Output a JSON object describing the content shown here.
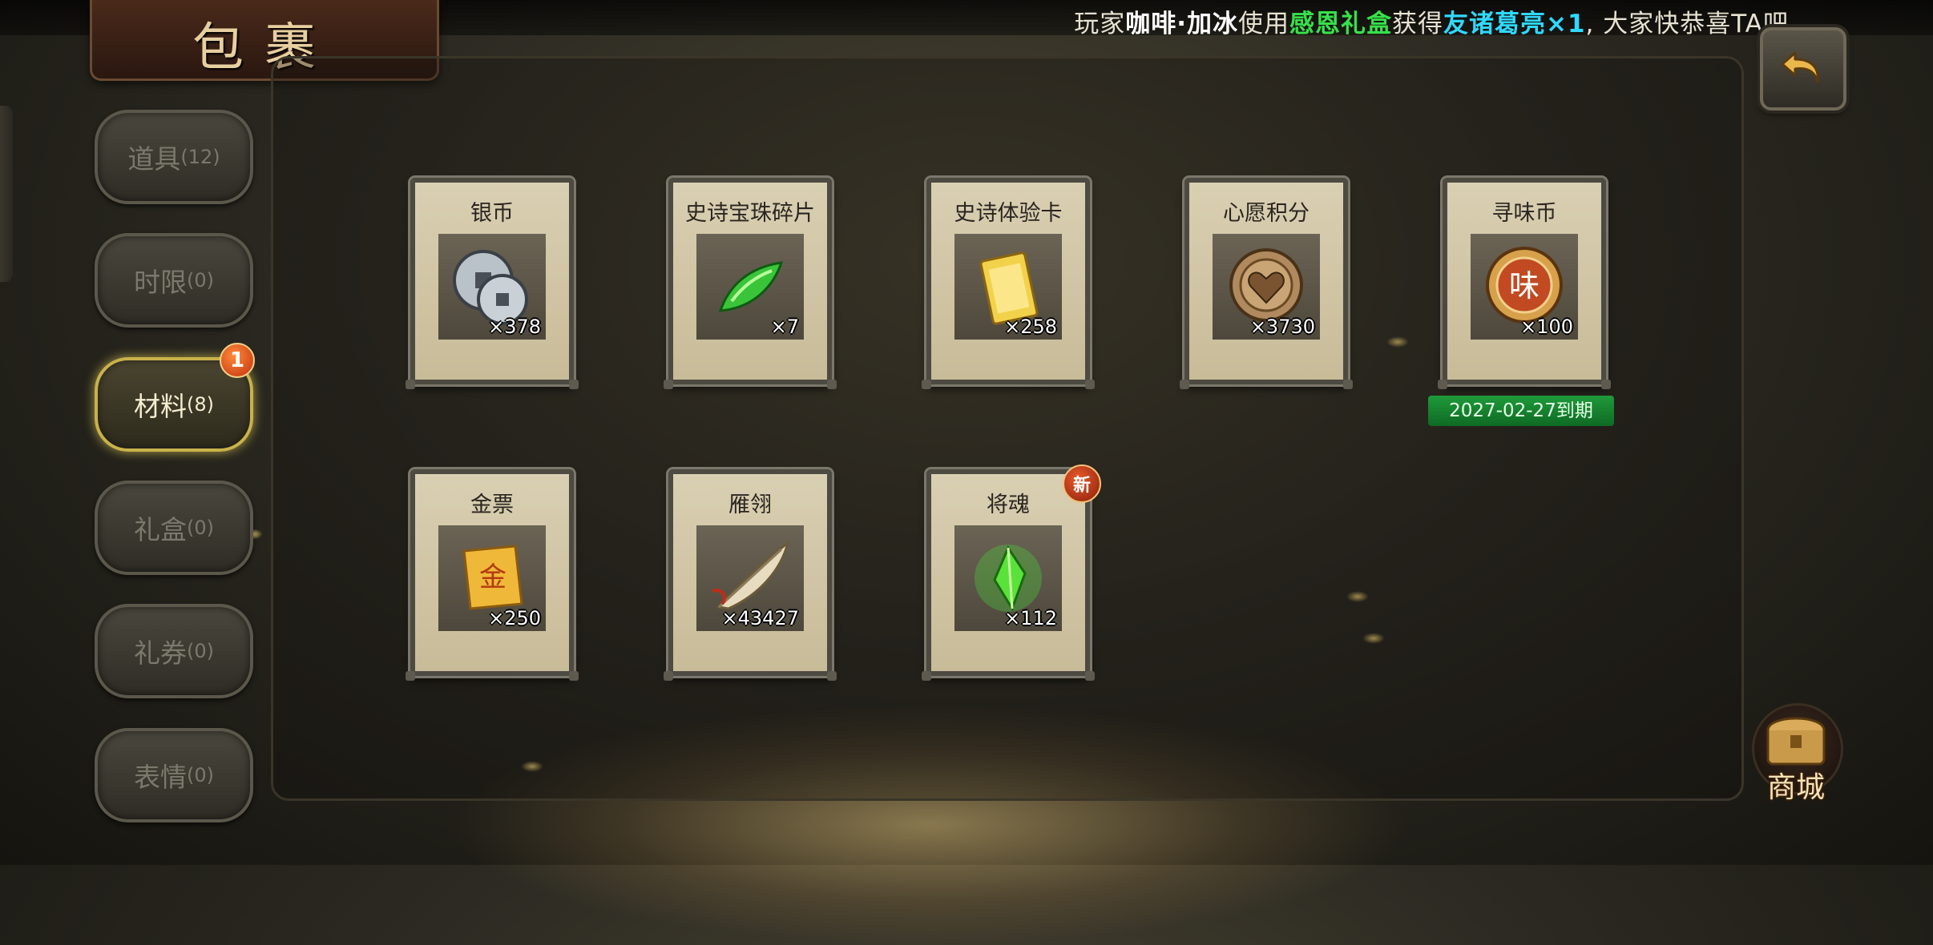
{
  "announcement": {
    "prefix": "玩家",
    "player": "咖啡·加冰",
    "mid1": "使用",
    "item_used": "感恩礼盒",
    "mid2": "获得",
    "reward": "友诸葛亮×1",
    "suffix": ", 大家快恭喜TA吧"
  },
  "title": "包裹",
  "tabs": [
    {
      "label": "道具",
      "count": "(12)",
      "active": false
    },
    {
      "label": "时限",
      "count": "(0)",
      "active": false
    },
    {
      "label": "材料",
      "count": "(8)",
      "active": true,
      "badge": "1"
    },
    {
      "label": "礼盒",
      "count": "(0)",
      "active": false
    },
    {
      "label": "礼券",
      "count": "(0)",
      "active": false
    },
    {
      "label": "表情",
      "count": "(0)",
      "active": false
    }
  ],
  "items": [
    {
      "name": "银币",
      "qty": "×378",
      "icon": "silver-coin-icon"
    },
    {
      "name": "史诗宝珠碎片",
      "qty": "×7",
      "icon": "green-shard-icon"
    },
    {
      "name": "史诗体验卡",
      "qty": "×258",
      "icon": "gold-card-icon"
    },
    {
      "name": "心愿积分",
      "qty": "×3730",
      "icon": "heart-coin-icon"
    },
    {
      "name": "寻味币",
      "qty": "×100",
      "icon": "flavor-coin-icon",
      "coin_char": "味",
      "expiry": "2027-02-27到期"
    },
    {
      "name": "金票",
      "qty": "×250",
      "icon": "gold-ticket-icon",
      "ticket_char": "金"
    },
    {
      "name": "雁翎",
      "qty": "×43427",
      "icon": "feather-icon"
    },
    {
      "name": "将魂",
      "qty": "×112",
      "icon": "soul-crystal-icon",
      "badge": "新"
    }
  ],
  "shop_label": "商城",
  "colors": {
    "green_highlight": "#37e04a",
    "cyan_highlight": "#30d8ff",
    "active_tab_border": "#c9b24a",
    "expiry_green": "#1f9a3a"
  }
}
